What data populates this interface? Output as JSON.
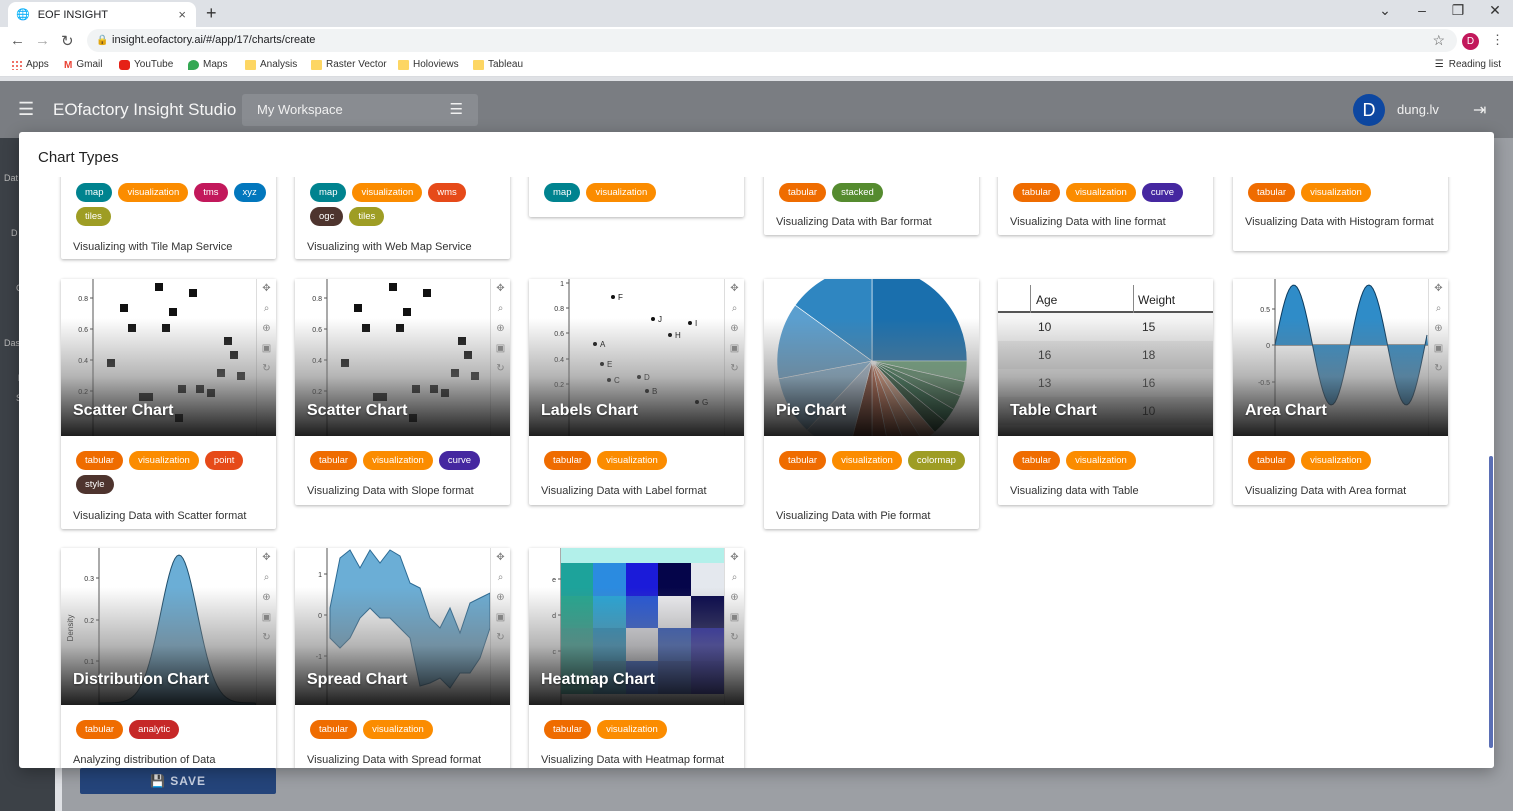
{
  "browser": {
    "tab_title": "EOF INSIGHT",
    "tab_close": "×",
    "new_tab": "+",
    "url": "insight.eofactory.ai/#/app/17/charts/create",
    "profile_initial": "D",
    "bookmarks": [
      "Apps",
      "Gmail",
      "YouTube",
      "Maps",
      "Analysis",
      "Raster Vector",
      "Holoviews",
      "Tableau"
    ],
    "reading_list": "Reading list"
  },
  "app": {
    "title": "EOfactory Insight Studio",
    "workspace": "My Workspace",
    "user_initial": "D",
    "user_name": "dung.lv",
    "save_label": "SAVE",
    "sidenav_fragments": [
      "Dat",
      "D",
      "C",
      "Das",
      "l",
      "S"
    ]
  },
  "modal": {
    "title": "Chart Types",
    "top_cards": [
      {
        "tags": [
          {
            "t": "map",
            "c": "#00838f"
          },
          {
            "t": "visualization",
            "c": "#fb8c00"
          },
          {
            "t": "tms",
            "c": "#c2185b"
          },
          {
            "t": "xyz",
            "c": "#0277bd"
          },
          {
            "t": "tiles",
            "c": "#9e9d24"
          }
        ],
        "desc": "Visualizing with Tile Map Service"
      },
      {
        "tags": [
          {
            "t": "map",
            "c": "#00838f"
          },
          {
            "t": "visualization",
            "c": "#fb8c00"
          },
          {
            "t": "wms",
            "c": "#e64a19"
          },
          {
            "t": "ogc",
            "c": "#4e342e"
          },
          {
            "t": "tiles",
            "c": "#9e9d24"
          }
        ],
        "desc": "Visualizing with Web Map Service"
      },
      {
        "tags": [
          {
            "t": "map",
            "c": "#00838f"
          },
          {
            "t": "visualization",
            "c": "#fb8c00"
          }
        ],
        "desc": ""
      },
      {
        "tags": [
          {
            "t": "tabular",
            "c": "#ef6c00"
          },
          {
            "t": "stacked",
            "c": "#558b2f"
          }
        ],
        "desc": "Visualizing Data with Bar format"
      },
      {
        "tags": [
          {
            "t": "tabular",
            "c": "#ef6c00"
          },
          {
            "t": "visualization",
            "c": "#fb8c00"
          },
          {
            "t": "curve",
            "c": "#4527a0"
          }
        ],
        "desc": "Visualizing Data with line format"
      },
      {
        "tags": [
          {
            "t": "tabular",
            "c": "#ef6c00"
          },
          {
            "t": "visualization",
            "c": "#fb8c00"
          }
        ],
        "desc": "Visualizing Data with Histogram format"
      }
    ],
    "cards": [
      {
        "title": "Scatter Chart",
        "tags": [
          {
            "t": "tabular",
            "c": "#ef6c00"
          },
          {
            "t": "visualization",
            "c": "#fb8c00"
          },
          {
            "t": "point",
            "c": "#e64a19"
          },
          {
            "t": "style",
            "c": "#4e342e"
          }
        ],
        "desc": "Visualizing Data with Scatter format"
      },
      {
        "title": "Scatter Chart",
        "tags": [
          {
            "t": "tabular",
            "c": "#ef6c00"
          },
          {
            "t": "visualization",
            "c": "#fb8c00"
          },
          {
            "t": "curve",
            "c": "#4527a0"
          }
        ],
        "desc": "Visualizing Data with Slope format"
      },
      {
        "title": "Labels Chart",
        "tags": [
          {
            "t": "tabular",
            "c": "#ef6c00"
          },
          {
            "t": "visualization",
            "c": "#fb8c00"
          }
        ],
        "desc": "Visualizing Data with Label format"
      },
      {
        "title": "Pie Chart",
        "tags": [
          {
            "t": "tabular",
            "c": "#ef6c00"
          },
          {
            "t": "visualization",
            "c": "#fb8c00"
          },
          {
            "t": "colormap",
            "c": "#9e9d24"
          }
        ],
        "desc": "Visualizing Data with Pie format"
      },
      {
        "title": "Table Chart",
        "tags": [
          {
            "t": "tabular",
            "c": "#ef6c00"
          },
          {
            "t": "visualization",
            "c": "#fb8c00"
          }
        ],
        "desc": "Visualizing data with Table"
      },
      {
        "title": "Area Chart",
        "tags": [
          {
            "t": "tabular",
            "c": "#ef6c00"
          },
          {
            "t": "visualization",
            "c": "#fb8c00"
          }
        ],
        "desc": "Visualizing Data with Area format"
      },
      {
        "title": "Distribution Chart",
        "tags": [
          {
            "t": "tabular",
            "c": "#ef6c00"
          },
          {
            "t": "analytic",
            "c": "#c62828"
          }
        ],
        "desc": "Analyzing distribution of Data"
      },
      {
        "title": "Spread Chart",
        "tags": [
          {
            "t": "tabular",
            "c": "#ef6c00"
          },
          {
            "t": "visualization",
            "c": "#fb8c00"
          }
        ],
        "desc": "Visualizing Data with Spread format"
      },
      {
        "title": "Heatmap Chart",
        "tags": [
          {
            "t": "tabular",
            "c": "#ef6c00"
          },
          {
            "t": "visualization",
            "c": "#fb8c00"
          }
        ],
        "desc": "Visualizing Data with Heatmap format"
      }
    ],
    "table_preview": {
      "headers": [
        "Age",
        "Weight"
      ],
      "rows": [
        [
          "10",
          "15"
        ],
        [
          "16",
          "18"
        ],
        [
          "13",
          "16"
        ],
        [
          "10",
          "10"
        ]
      ]
    },
    "labels_preview": [
      "F",
      "J",
      "I",
      "H",
      "A",
      "E",
      "D",
      "C",
      "B",
      "G"
    ]
  }
}
